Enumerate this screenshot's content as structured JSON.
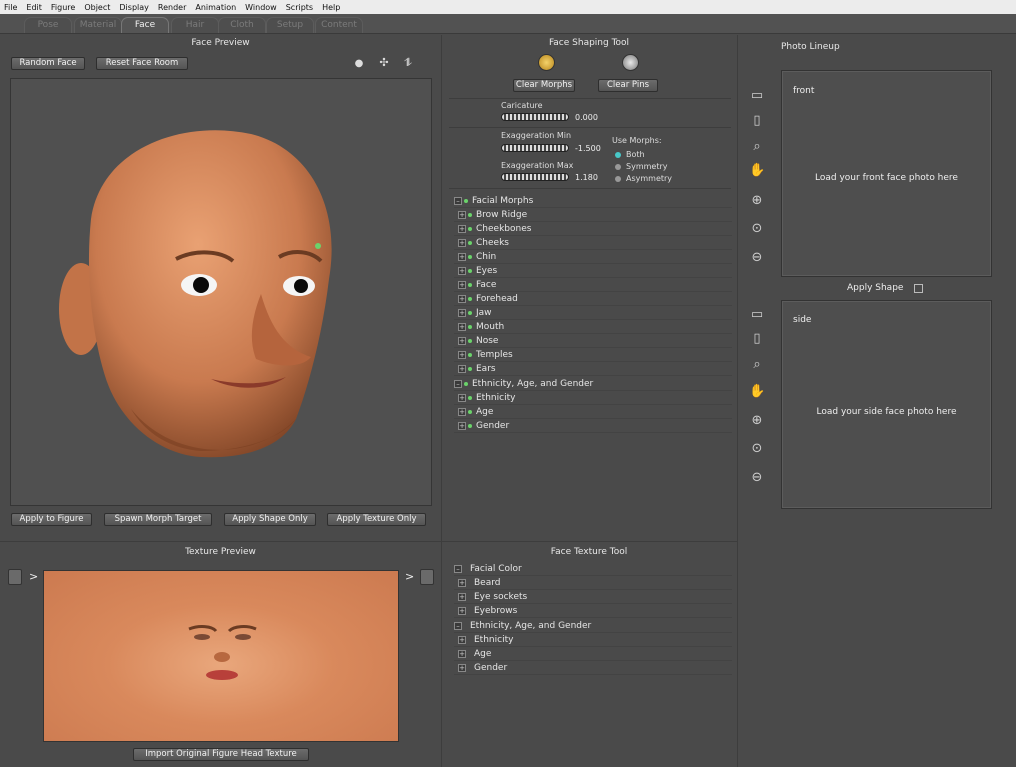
{
  "menu": [
    "File",
    "Edit",
    "Figure",
    "Object",
    "Display",
    "Render",
    "Animation",
    "Window",
    "Scripts",
    "Help"
  ],
  "tabs": [
    "Pose",
    "Material",
    "Face",
    "Hair",
    "Cloth",
    "Setup",
    "Content"
  ],
  "face_preview": {
    "title": "Face Preview",
    "random_face": "Random Face",
    "reset_face_room": "Reset Face Room",
    "apply_to_figure": "Apply to Figure",
    "spawn_morph_target": "Spawn Morph Target",
    "apply_shape_only": "Apply Shape Only",
    "apply_texture_only": "Apply Texture Only"
  },
  "texture_preview": {
    "title": "Texture Preview",
    "import_button": "Import Original Figure Head Texture",
    "arrow": ">"
  },
  "face_shaping": {
    "title": "Face Shaping Tool",
    "clear_morphs": "Clear Morphs",
    "clear_pins": "Clear Pins",
    "caricature_label": "Caricature",
    "caricature_value": "0.000",
    "exag_min_label": "Exaggeration Min",
    "exag_min_value": "-1.500",
    "exag_max_label": "Exaggeration Max",
    "exag_max_value": "1.180",
    "use_morphs_label": "Use Morphs:",
    "use_morphs_options": [
      "Both",
      "Symmetry",
      "Asymmetry"
    ],
    "use_morphs_selected": "Both",
    "tree": [
      {
        "label": "Facial Morphs",
        "level": 0
      },
      {
        "label": "Brow Ridge",
        "level": 1
      },
      {
        "label": "Cheekbones",
        "level": 1
      },
      {
        "label": "Cheeks",
        "level": 1
      },
      {
        "label": "Chin",
        "level": 1
      },
      {
        "label": "Eyes",
        "level": 1
      },
      {
        "label": "Face",
        "level": 1
      },
      {
        "label": "Forehead",
        "level": 1
      },
      {
        "label": "Jaw",
        "level": 1
      },
      {
        "label": "Mouth",
        "level": 1
      },
      {
        "label": "Nose",
        "level": 1
      },
      {
        "label": "Temples",
        "level": 1
      },
      {
        "label": "Ears",
        "level": 1
      },
      {
        "label": "Ethnicity, Age, and Gender",
        "level": 0
      },
      {
        "label": "Ethnicity",
        "level": 1
      },
      {
        "label": "Age",
        "level": 1
      },
      {
        "label": "Gender",
        "level": 1
      }
    ]
  },
  "face_texture": {
    "title": "Face Texture Tool",
    "tree": [
      {
        "label": "Facial Color",
        "level": 0
      },
      {
        "label": "Beard",
        "level": 1
      },
      {
        "label": "Eye sockets",
        "level": 1
      },
      {
        "label": "Eyebrows",
        "level": 1
      },
      {
        "label": "Ethnicity, Age, and Gender",
        "level": 0
      },
      {
        "label": "Ethnicity",
        "level": 1
      },
      {
        "label": "Age",
        "level": 1
      },
      {
        "label": "Gender",
        "level": 1
      }
    ]
  },
  "photo_lineup": {
    "title": "Photo Lineup",
    "front_label": "front",
    "front_hint": "Load your front face photo here",
    "apply_shape": "Apply Shape",
    "side_label": "side",
    "side_hint": "Load your side face photo here",
    "tools": [
      "folder-icon",
      "trash-icon",
      "magnifier-icon",
      "hand-icon",
      "zoom-in-icon",
      "zoom-reset-icon",
      "zoom-out-icon"
    ]
  },
  "colors": {
    "background": "#4a4a4a",
    "accent_green": "#6bd36b",
    "radio_on": "#48c8c8",
    "skin": "#d98a5e"
  }
}
